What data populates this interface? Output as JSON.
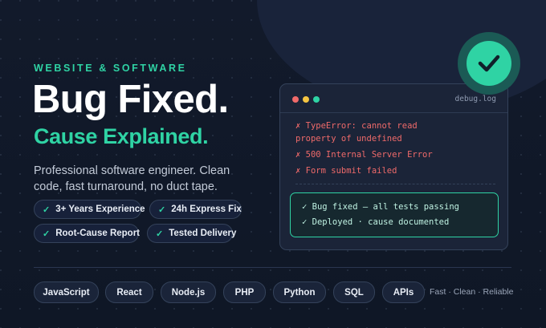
{
  "hero": {
    "eyebrow": "WEBSITE & SOFTWARE",
    "title": "Bug Fixed.",
    "subtitle": "Cause Explained.",
    "description": "Professional software engineer. Clean code, fast turnaround, no duct tape."
  },
  "features": [
    {
      "label": "3+ Years Experience"
    },
    {
      "label": "24h Express Fix"
    },
    {
      "label": "Root-Cause Report"
    },
    {
      "label": "Tested Delivery"
    }
  ],
  "check_glyph": "✓",
  "terminal": {
    "filename": "debug.log",
    "errors": [
      "✗ TypeError: cannot read",
      "property of undefined",
      "✗ 500 Internal Server Error",
      "✗ Form submit failed"
    ],
    "success": [
      "✓ Bug fixed — all tests passing",
      "✓ Deployed · cause documented"
    ],
    "dot_colors": [
      "#f06a6a",
      "#f5c542",
      "#2fd3a4"
    ]
  },
  "tech_tags": [
    "JavaScript",
    "React",
    "Node.js",
    "PHP",
    "Python",
    "SQL",
    "APIs"
  ],
  "tagline": "Fast · Clean · Reliable",
  "colors": {
    "accent": "#2fd3a4",
    "background": "#121a2b",
    "error": "#f06a6a"
  },
  "badge_icon": "checkmark-icon"
}
